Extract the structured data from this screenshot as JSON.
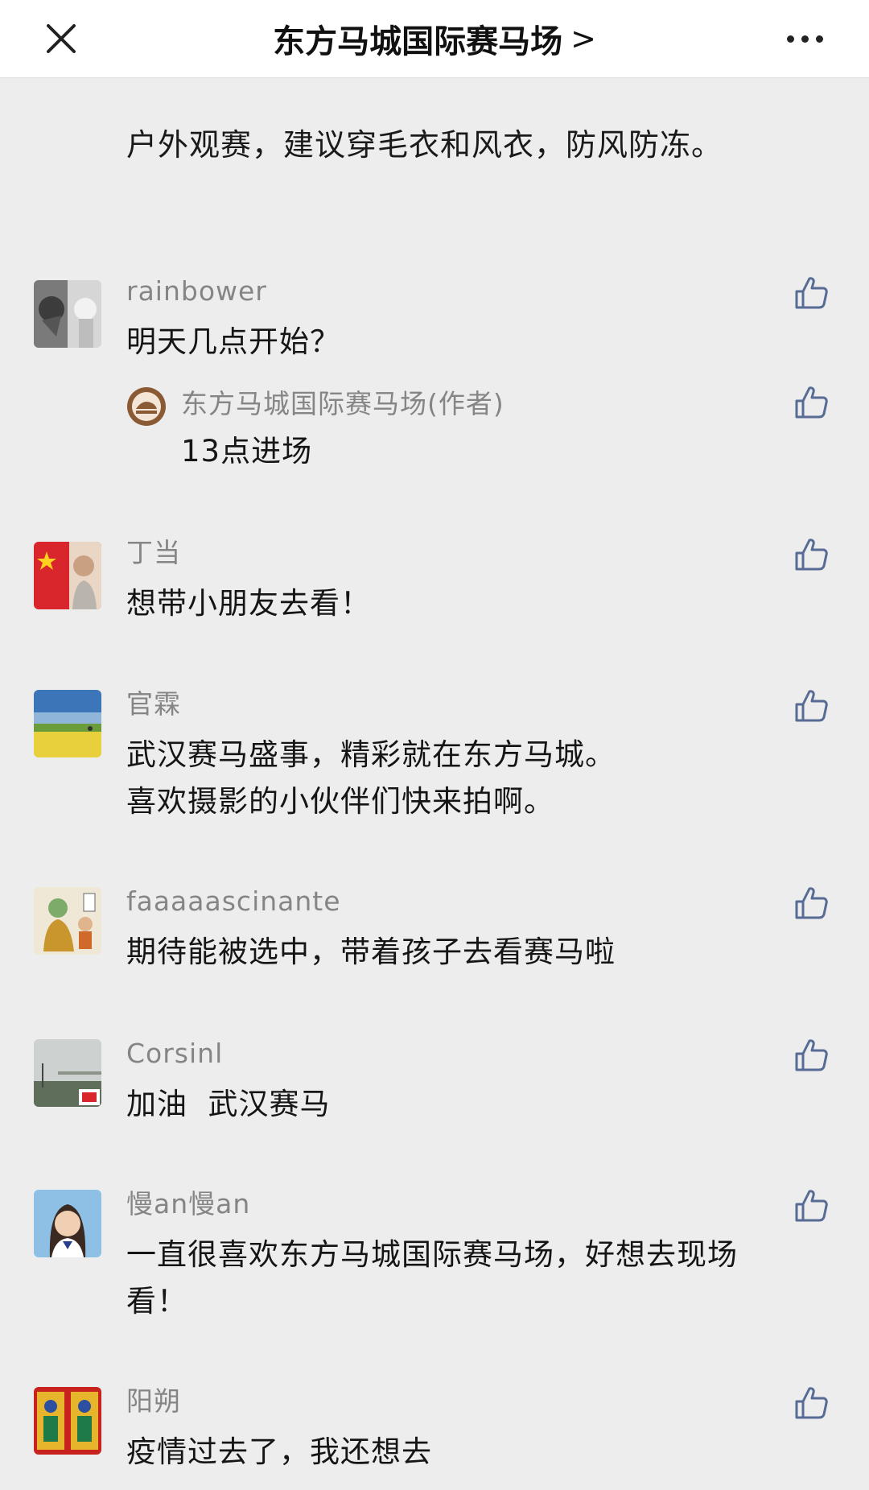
{
  "header": {
    "title": "东方马城国际赛马场",
    "chevron": ">"
  },
  "notice": "户外观赛，建议穿毛衣和风衣，防风防冻。",
  "comments": [
    {
      "user": "rainbower",
      "text": "明天几点开始？",
      "reply": {
        "user": "东方马城国际赛马场(作者)",
        "text": "13点进场"
      }
    },
    {
      "user": "丁当",
      "text": "想带小朋友去看！"
    },
    {
      "user": "官霖",
      "text": "武汉赛马盛事，精彩就在东方马城。\n喜欢摄影的小伙伴们快来拍啊。"
    },
    {
      "user": "faaaaascinante",
      "text": "期待能被选中，带着孩子去看赛马啦"
    },
    {
      "user": "Corsinl",
      "text": "加油  武汉赛马"
    },
    {
      "user": "慢an慢an",
      "text": "一直很喜欢东方马城国际赛马场，好想去现场\n看！"
    },
    {
      "user": "阳朔",
      "text": "疫情过去了，我还想去"
    }
  ],
  "icons": {
    "close": "close-icon",
    "more": "more-icon",
    "like": "thumbs-up-icon"
  },
  "colors": {
    "background": "#ededed",
    "username": "#858585",
    "like_icon": "#576b95"
  }
}
